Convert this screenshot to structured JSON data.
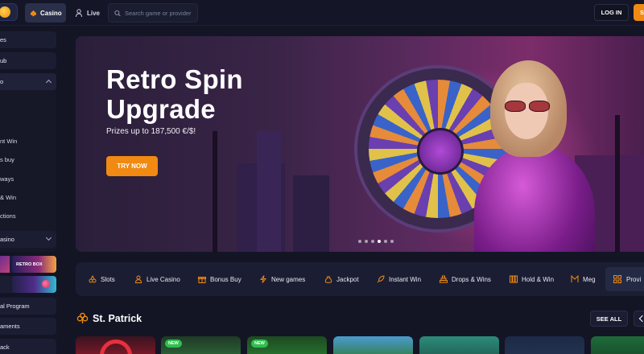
{
  "header": {
    "nav": {
      "casino": "Casino",
      "live": "Live"
    },
    "search_placeholder": "Search game or provider",
    "login_label": "LOG IN",
    "signup_label": "S"
  },
  "sidebar": {
    "items": [
      {
        "label": "es"
      },
      {
        "label": "ub"
      },
      {
        "label": "o"
      }
    ],
    "subitems": [
      {
        "label": "nt Win"
      },
      {
        "label": "s buy"
      },
      {
        "label": "ways"
      },
      {
        "label": "& Win"
      },
      {
        "label": "ctions"
      }
    ],
    "casino_group": {
      "label": "asino"
    },
    "promo_retro": {
      "label": "RETRO BOX"
    },
    "bottom_items": [
      {
        "label": "al Program"
      },
      {
        "label": "aments"
      },
      {
        "label": "ack"
      }
    ]
  },
  "banner": {
    "title_line1": "Retro Spin",
    "title_line2": "Upgrade",
    "subtitle": "Prizes up to 187,500 €/$!",
    "cta": "TRY NOW",
    "slide_count": 6,
    "active_slide": 3
  },
  "categories": [
    {
      "label": "Slots",
      "icon": "cherries-icon"
    },
    {
      "label": "Live Casino",
      "icon": "dealer-icon"
    },
    {
      "label": "Bonus Buy",
      "icon": "gift-icon"
    },
    {
      "label": "New games",
      "icon": "lightning-icon"
    },
    {
      "label": "Jackpot",
      "icon": "money-bag-icon"
    },
    {
      "label": "Instant Win",
      "icon": "rocket-icon"
    },
    {
      "label": "Drops & Wins",
      "icon": "pyramid-icon"
    },
    {
      "label": "Hold & Win",
      "icon": "coins-icon"
    },
    {
      "label": "Meg",
      "icon": "mega-icon"
    }
  ],
  "providers_label": "Provi",
  "section": {
    "title": "St. Patrick",
    "see_all": "SEE ALL",
    "tiles": [
      {
        "badge": ""
      },
      {
        "badge": "NEW"
      },
      {
        "badge": "NEW"
      },
      {
        "badge": ""
      },
      {
        "badge": ""
      },
      {
        "badge": ""
      },
      {
        "badge": ""
      }
    ]
  },
  "colors": {
    "background": "#131525",
    "accent": "#f08a12",
    "panel": "#1b1e33",
    "new_badge": "#2fbf4f"
  }
}
